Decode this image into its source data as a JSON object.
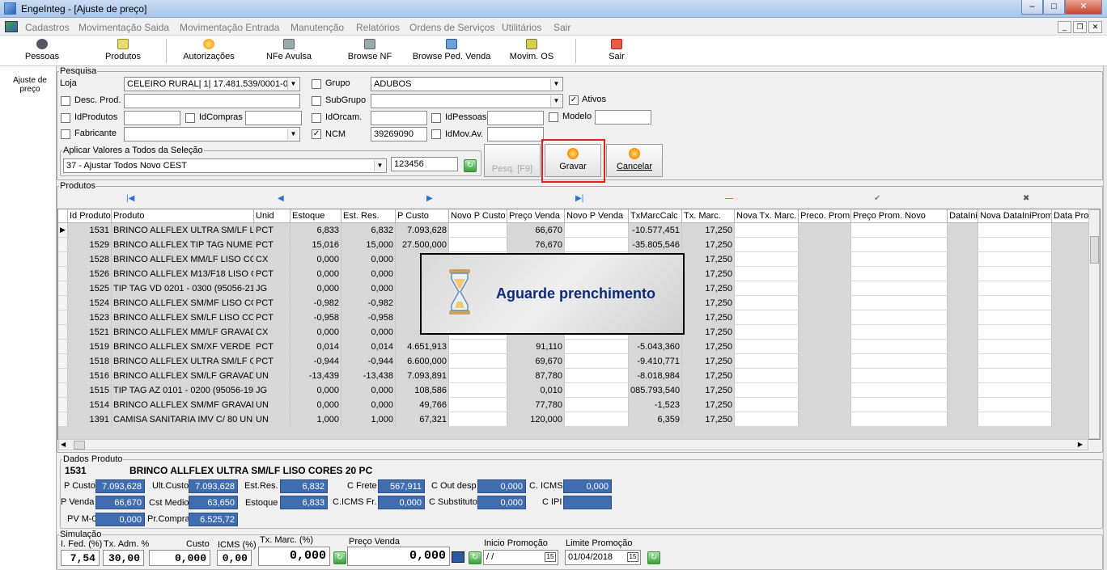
{
  "window": {
    "title": "EngeInteg - [Ajuste de preço]"
  },
  "menu": [
    "Cadastros",
    "Movimentação Saida",
    "Movimentação Entrada",
    "Manutenção",
    "Relatórios",
    "Ordens de Serviços",
    "Utilitários",
    "Sair"
  ],
  "toolbar": [
    "Pessoas",
    "Produtos",
    "Autorizações",
    "NFe Avulsa",
    "Browse NF",
    "Browse Ped. Venda",
    "Movim. OS",
    "Sair"
  ],
  "sidebar": {
    "item": "Ajuste de preço"
  },
  "pesquisa": {
    "legend": "Pesquisa",
    "loja_label": "Loja",
    "loja_value": "CELEIRO RURAL| 1| 17.481.539/0001-0",
    "grupo_label": "Grupo",
    "grupo_value": "ADUBOS",
    "desc_label": "Desc. Prod.",
    "subgrupo_label": "SubGrupo",
    "ativos_label": "Ativos",
    "idprodutos_label": "IdProdutos",
    "idcompras_label": "IdCompras",
    "idorcam_label": "IdOrcam.",
    "idpessoas_label": "IdPessoas",
    "modelo_label": "Modelo",
    "fabricante_label": "Fabricante",
    "ncm_label": "NCM",
    "ncm_value": "39269090",
    "idmov_label": "IdMov.Av.",
    "aplicar_legend": "Aplicar Valores a Todos da Seleção",
    "aplicar_value": "37 - Ajustar Todos Novo CEST",
    "aplicar_input": "123456",
    "pesq_btn": "Pesq. [F9]",
    "gravar_btn": "Gravar",
    "cancelar_btn": "Cancelar"
  },
  "produtos": {
    "legend": "Produtos",
    "columns": [
      "Id Produto",
      "Produto",
      "Unid",
      "Estoque",
      "Est. Res.",
      "P Custo",
      "Novo P Custo",
      "Preço Venda",
      "Novo P Venda",
      "TxMarcCalc",
      "Tx. Marc.",
      "Nova Tx. Marc.",
      "Preco. Prom.",
      "Preço Prom. Novo",
      "DataIniProm",
      "Nova DataIniProm",
      "Data Pro"
    ],
    "rows": [
      [
        "1531",
        "BRINCO ALLFLEX ULTRA SM/LF LISO CORES",
        "PCT",
        "6,833",
        "6,832",
        "7.093,628",
        "",
        "66,670",
        "",
        "-10.577,451",
        "17,250"
      ],
      [
        "1529",
        "BRINCO ALLFLEX TIP TAG NUMERADO",
        "PCT",
        "15,016",
        "15,000",
        "27.500,000",
        "",
        "76,670",
        "",
        "-35.805,546",
        "17,250"
      ],
      [
        "1528",
        "BRINCO ALLFLEX MM/LF LISO CORES",
        "CX",
        "0,000",
        "0,000",
        "",
        "",
        "",
        "",
        "",
        "17,250"
      ],
      [
        "1526",
        "BRINCO ALLFLEX M13/F18 LISO CORES",
        "PCT",
        "0,000",
        "0,000",
        "",
        "",
        "",
        "",
        "",
        "17,250"
      ],
      [
        "1525",
        "TIP TAG VD 0201 - 0300 (95056-21",
        "JG",
        "0,000",
        "0,000",
        "",
        "",
        "",
        "",
        "",
        "17,250"
      ],
      [
        "1524",
        "BRINCO ALLFLEX SM/MF LISO CORES",
        "PCT",
        "-0,982",
        "-0,982",
        "6.45",
        "",
        "",
        "",
        "",
        "17,250"
      ],
      [
        "1523",
        "BRINCO ALLFLEX SM/LF LISO CORES",
        "PCT",
        "-0,958",
        "-0,958",
        "7.05",
        "",
        "",
        "",
        "",
        "17,250"
      ],
      [
        "1521",
        "BRINCO ALLFLEX MM/LF GRAVADO",
        "CX",
        "0,000",
        "0,000",
        "",
        "",
        "",
        "",
        "",
        "17,250"
      ],
      [
        "1519",
        "BRINCO ALLFLEX SM/XF VERDE LISO",
        "PCT",
        "0,014",
        "0,014",
        "4.651,913",
        "",
        "91,110",
        "",
        "-5.043,360",
        "17,250"
      ],
      [
        "1518",
        "BRINCO ALLFLEX ULTRA SM/LF GRAVADO",
        "PCT",
        "-0,944",
        "-0,944",
        "6.600,000",
        "",
        "69,670",
        "",
        "-9.410,771",
        "17,250"
      ],
      [
        "1516",
        "BRINCO ALLFLEX SM/LF GRAVADO",
        "UN",
        "-13,439",
        "-13,438",
        "7.093,891",
        "",
        "87,780",
        "",
        "-8.018,984",
        "17,250"
      ],
      [
        "1515",
        "TIP TAG AZ 0101 - 0200 (95056-19",
        "JG",
        "0,000",
        "0,000",
        "108,586",
        "",
        "0,010",
        "",
        "085.793,540",
        "17,250"
      ],
      [
        "1514",
        "BRINCO ALLFLEX SM/MF GRAVADO",
        "UN",
        "0,000",
        "0,000",
        "49,766",
        "",
        "77,780",
        "",
        "-1,523",
        "17,250"
      ],
      [
        "1391",
        "CAMISA SANITARIA IMV C/ 80 UN",
        "UN",
        "1,000",
        "1,000",
        "67,321",
        "",
        "120,000",
        "",
        "6,359",
        "17,250"
      ]
    ]
  },
  "overlay": {
    "message": "Aguarde prenchimento"
  },
  "dados": {
    "legend": "Dados Produto",
    "id": "1531",
    "nome": "BRINCO ALLFLEX ULTRA SM/LF LISO CORES 20 PC",
    "p_custo_label": "P Custo",
    "p_custo": "7.093,628",
    "ult_custo_label": "Ult.Custo",
    "ult_custo": "7.093,628",
    "est_res_label": "Est.Res.",
    "est_res": "6,832",
    "c_frete_label": "C Frete",
    "c_frete": "567,911",
    "c_out_label": "C Out desp",
    "c_out": "0,000",
    "c_icms_label": "C. ICMS",
    "c_icms": "0,000",
    "p_venda_label": "P Venda",
    "p_venda": "66,670",
    "cst_medio_label": "Cst Medio",
    "cst_medio": "63,650",
    "estoque_label": "Estoque",
    "estoque": "6,833",
    "cicms_fr_label": "C.ICMS Fr.",
    "cicms_fr": "0,000",
    "c_subst_label": "C Substituto",
    "c_subst": "0,000",
    "c_ipi_label": "C IPI",
    "c_ipi": "",
    "pv_m0_label": "PV M-0",
    "pv_m0": "0,000",
    "pr_compra_label": "Pr.Compra",
    "pr_compra": "6.525,72"
  },
  "simulacao": {
    "legend": "Simulação",
    "ifed_label": "I. Fed. (%)",
    "ifed": "7,54",
    "txadm_label": "Tx. Adm. %",
    "txadm": "30,00",
    "custo_label": "Custo",
    "custo": "0,000",
    "icms_label": "ICMS (%)",
    "icms": "0,00",
    "txmarc_label": "Tx. Marc. (%)",
    "txmarc": "0,000",
    "pvenda_label": "Preço Venda",
    "pvenda": "0,000",
    "inicio_label": "Inicio Promoção",
    "inicio": " / /",
    "limite_label": "Limite Promoção",
    "limite": "01/04/2018"
  }
}
